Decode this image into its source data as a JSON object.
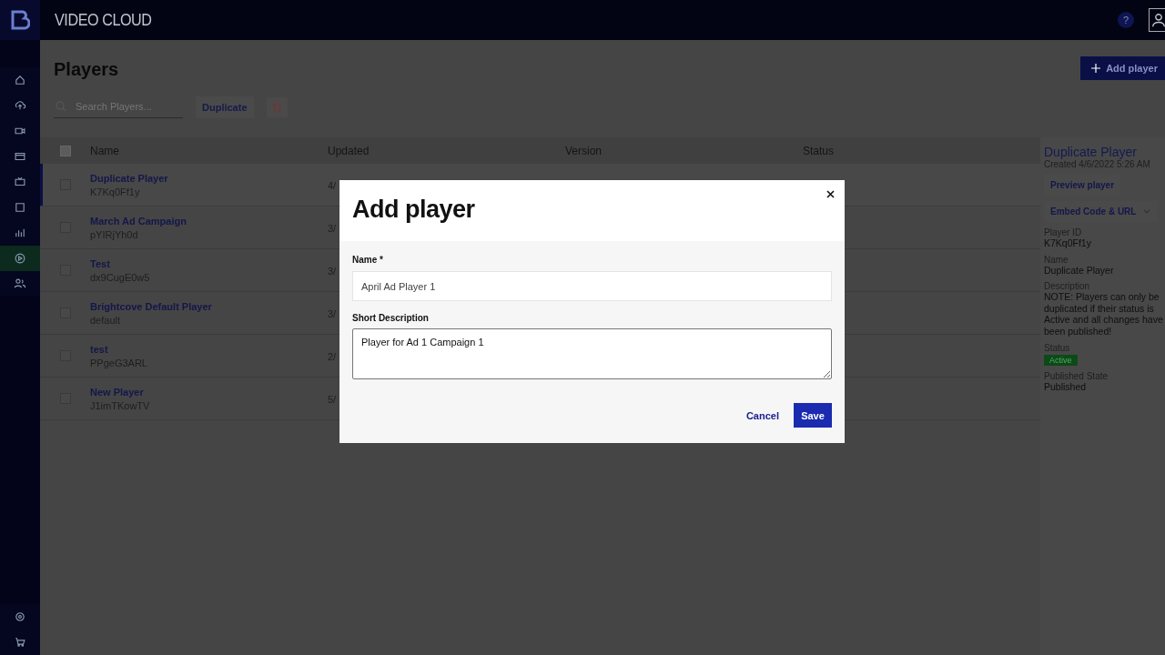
{
  "app": {
    "brand": "VIDEO CLOUD",
    "help": "?"
  },
  "sidebar": {
    "items": [
      {
        "kind": "home",
        "selected": false
      },
      {
        "kind": "upload",
        "selected": false
      },
      {
        "kind": "video",
        "selected": false
      },
      {
        "kind": "window",
        "selected": false
      },
      {
        "kind": "tv",
        "selected": false
      },
      {
        "kind": "square",
        "selected": false
      },
      {
        "kind": "chart",
        "selected": false
      },
      {
        "kind": "play",
        "selected": true
      },
      {
        "kind": "users",
        "selected": false
      }
    ],
    "bottom": [
      {
        "kind": "gear"
      },
      {
        "kind": "cart"
      }
    ]
  },
  "page": {
    "title": "Players",
    "add_button": "Add player",
    "search": {
      "placeholder": "Search Players..."
    },
    "duplicate_button": "Duplicate"
  },
  "table": {
    "columns": [
      "Name",
      "Updated",
      "Version",
      "Status"
    ],
    "header_checked": false,
    "rows": [
      {
        "name": "Duplicate Player",
        "id": "K7Kq0Ff1y",
        "updated": "4/",
        "selected": true,
        "checked": false
      },
      {
        "name": "March Ad Campaign",
        "id": "pYIRjYh0d",
        "updated": "3/",
        "selected": false,
        "checked": false
      },
      {
        "name": "Test",
        "id": "dx9CugE0w5",
        "updated": "3/",
        "selected": false,
        "checked": false
      },
      {
        "name": "Brightcove Default Player",
        "id": "default",
        "updated": "3/",
        "selected": false,
        "checked": false
      },
      {
        "name": "test",
        "id": "PPgeG3ARL",
        "updated": "2/",
        "selected": false,
        "checked": false
      },
      {
        "name": "New Player",
        "id": "J1imTKowTV",
        "updated": "5/",
        "selected": false,
        "checked": false
      }
    ]
  },
  "details": {
    "title": "Duplicate Player",
    "created": "Created 4/6/2022 5:26 AM",
    "preview_button": "Preview player",
    "embed_button": "Embed Code & URL",
    "fields": [
      {
        "label": "Player ID",
        "value": "K7Kq0Ff1y",
        "kind": "text"
      },
      {
        "label": "Name",
        "value": "Duplicate Player",
        "kind": "text"
      },
      {
        "label": "Description",
        "value": "NOTE: Players can only be duplicated if their status is Active and all changes have been published!",
        "kind": "text"
      },
      {
        "label": "Status",
        "value": "Active",
        "kind": "badge"
      },
      {
        "label": "Published State",
        "value": "Published",
        "kind": "text"
      }
    ]
  },
  "modal": {
    "title": "Add player",
    "name_label": "Name *",
    "name_value": "April Ad Player 1",
    "description_label": "Short Description",
    "description_value": "Player for Ad 1 Campaign 1",
    "cancel_button": "Cancel",
    "save_button": "Save"
  }
}
